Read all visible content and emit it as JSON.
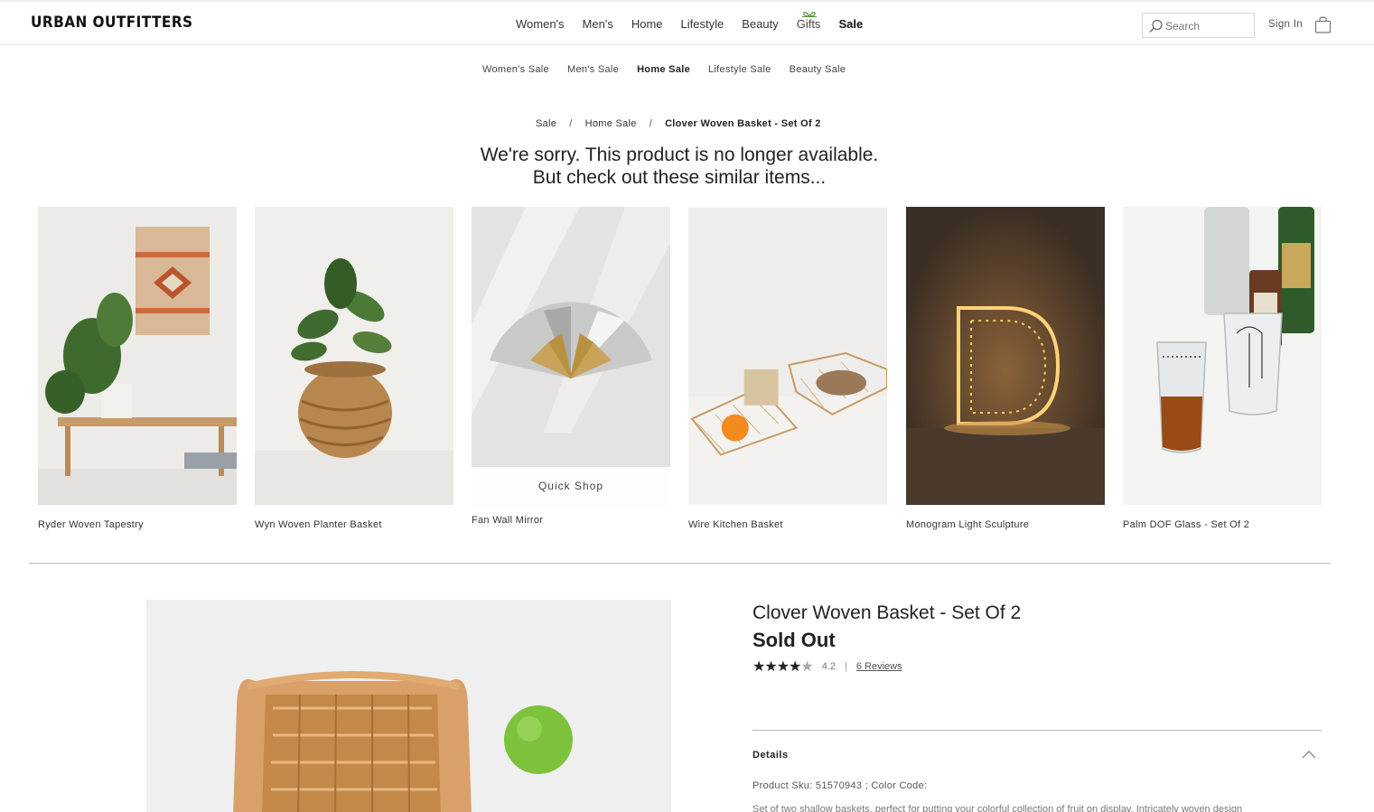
{
  "header": {
    "logo": "URBAN OUTFITTERS",
    "nav": [
      "Women's",
      "Men's",
      "Home",
      "Lifestyle",
      "Beauty",
      "Gifts",
      "Sale"
    ],
    "search_placeholder": "Search",
    "sign_in": "Sign In"
  },
  "subnav": [
    "Women's Sale",
    "Men's Sale",
    "Home Sale",
    "Lifestyle Sale",
    "Beauty Sale"
  ],
  "breadcrumb": [
    "Sale",
    "Home Sale",
    "Clover Woven Basket - Set Of 2"
  ],
  "sorry": {
    "line1": "We're sorry. This product is no longer available.",
    "line2": "But check out these similar items..."
  },
  "similar_items": [
    {
      "name": "Ryder Woven Tapestry"
    },
    {
      "name": "Wyn Woven Planter Basket"
    },
    {
      "name": "Fan Wall Mirror",
      "overlay": "Quick Shop"
    },
    {
      "name": "Wire Kitchen Basket"
    },
    {
      "name": "Monogram Light Sculpture"
    },
    {
      "name": "Palm DOF Glass - Set Of 2"
    }
  ],
  "product": {
    "title": "Clover Woven Basket - Set Of 2",
    "status": "Sold Out",
    "stars": "★★★★",
    "star_empty": "★",
    "rating": "4.2",
    "separator": "|",
    "reviews": "6 Reviews",
    "details_heading": "Details",
    "sku_line": "Product Sku: 51570943 ; Color Code:",
    "description": "Set of two shallow baskets, perfect for putting your colorful collection of fruit on display. Intricately woven design"
  },
  "colors": {
    "gift_green": "#5a9a3a",
    "text": "#222222"
  }
}
